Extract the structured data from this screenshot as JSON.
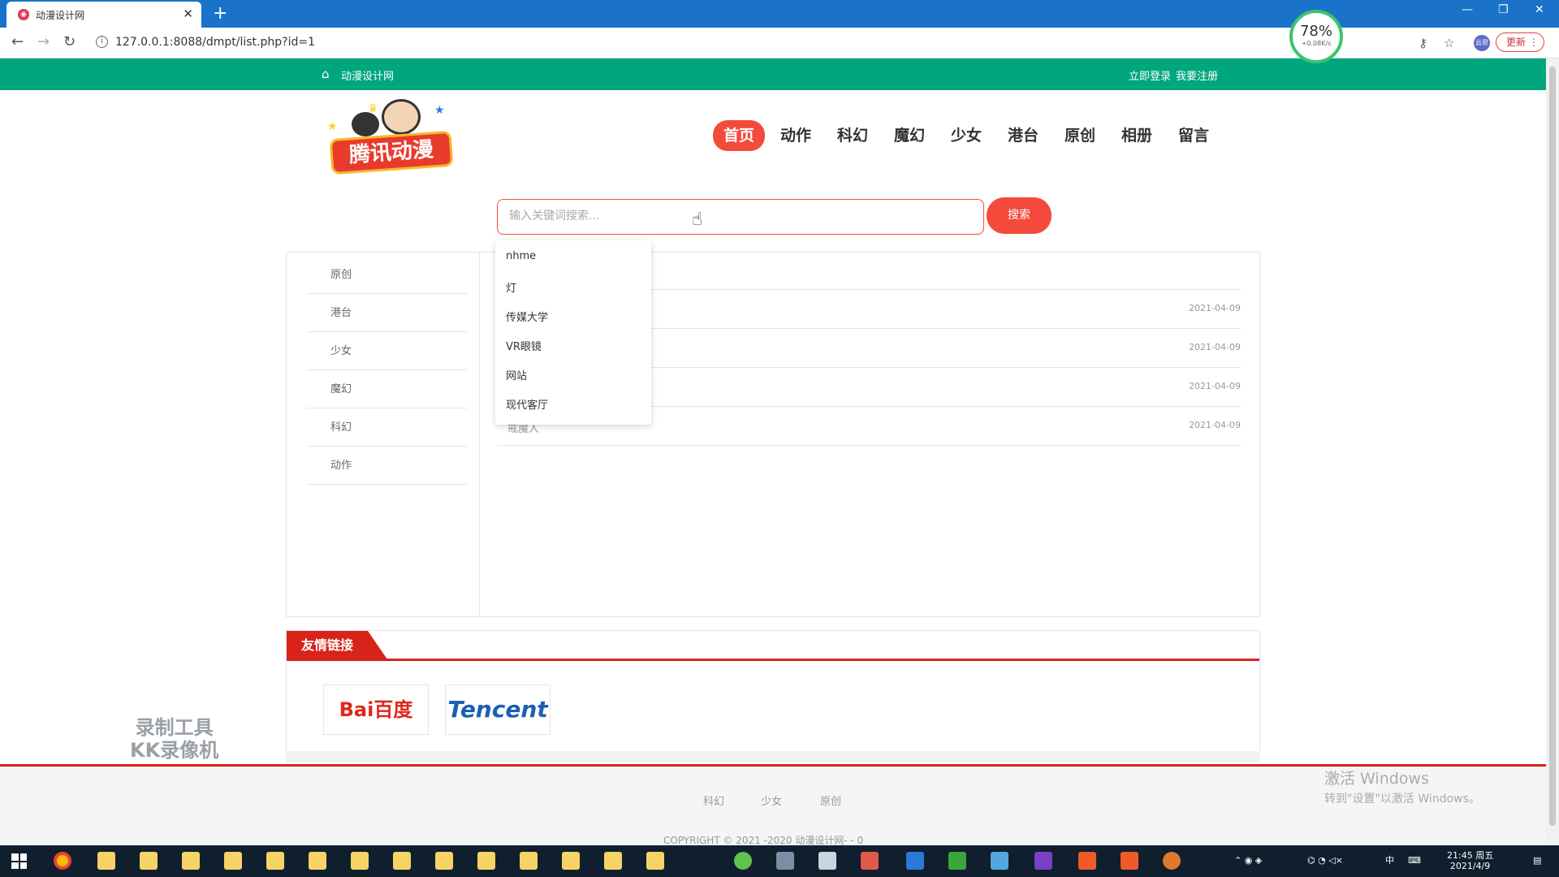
{
  "browser": {
    "tab_title": "动漫设计网",
    "tab_close": "✕",
    "newtab": "+",
    "url": "127.0.0.1:8088/dmpt/list.php?id=1",
    "update_label": "更新",
    "profile_label": "云思",
    "speed_percent": "78%",
    "speed_rate": "+0.08K/s"
  },
  "topbar": {
    "site_name": "动漫设计网",
    "login": "立即登录",
    "register": "我要注册"
  },
  "logo": {
    "text": "腾讯动漫"
  },
  "nav": [
    {
      "label": "首页",
      "active": true
    },
    {
      "label": "动作"
    },
    {
      "label": "科幻"
    },
    {
      "label": "魔幻"
    },
    {
      "label": "少女"
    },
    {
      "label": "港台"
    },
    {
      "label": "原创"
    },
    {
      "label": "相册"
    },
    {
      "label": "留言"
    }
  ],
  "search": {
    "placeholder": "输入关键词搜索...",
    "button": "搜索",
    "suggestions": [
      "nhme",
      "灯",
      "传媒大学",
      "VR眼镜",
      "网站",
      "现代客厅"
    ]
  },
  "sidebar": {
    "items": [
      "原创",
      "港台",
      "少女",
      "魔幻",
      "科幻",
      "动作"
    ]
  },
  "list": {
    "rows": [
      {
        "title": "",
        "date": "2021-04-09"
      },
      {
        "title": "",
        "date": "2021-04-09"
      },
      {
        "title": "",
        "date": "2021-04-09"
      },
      {
        "title": "戒魔人",
        "date": "2021-04-09"
      }
    ]
  },
  "links": {
    "heading": "友情链接",
    "items": [
      "Bai百度",
      "Tencent"
    ]
  },
  "footer": {
    "links": [
      "科幻",
      "少女",
      "原创"
    ],
    "copyright": "COPYRIGHT © 2021 -2020 动漫设计网- - 0"
  },
  "overlay": {
    "watermark_line1": "录制工具",
    "watermark_line2": "KK录像机",
    "activate_title": "激活 Windows",
    "activate_sub": "转到\"设置\"以激活 Windows。"
  },
  "taskbar": {
    "time": "21:45 周五",
    "date": "2021/4/9",
    "ime": "中"
  },
  "colors": {
    "topbar": "#00a67e",
    "accent": "#f44a3b",
    "links_red": "#d8231b"
  }
}
